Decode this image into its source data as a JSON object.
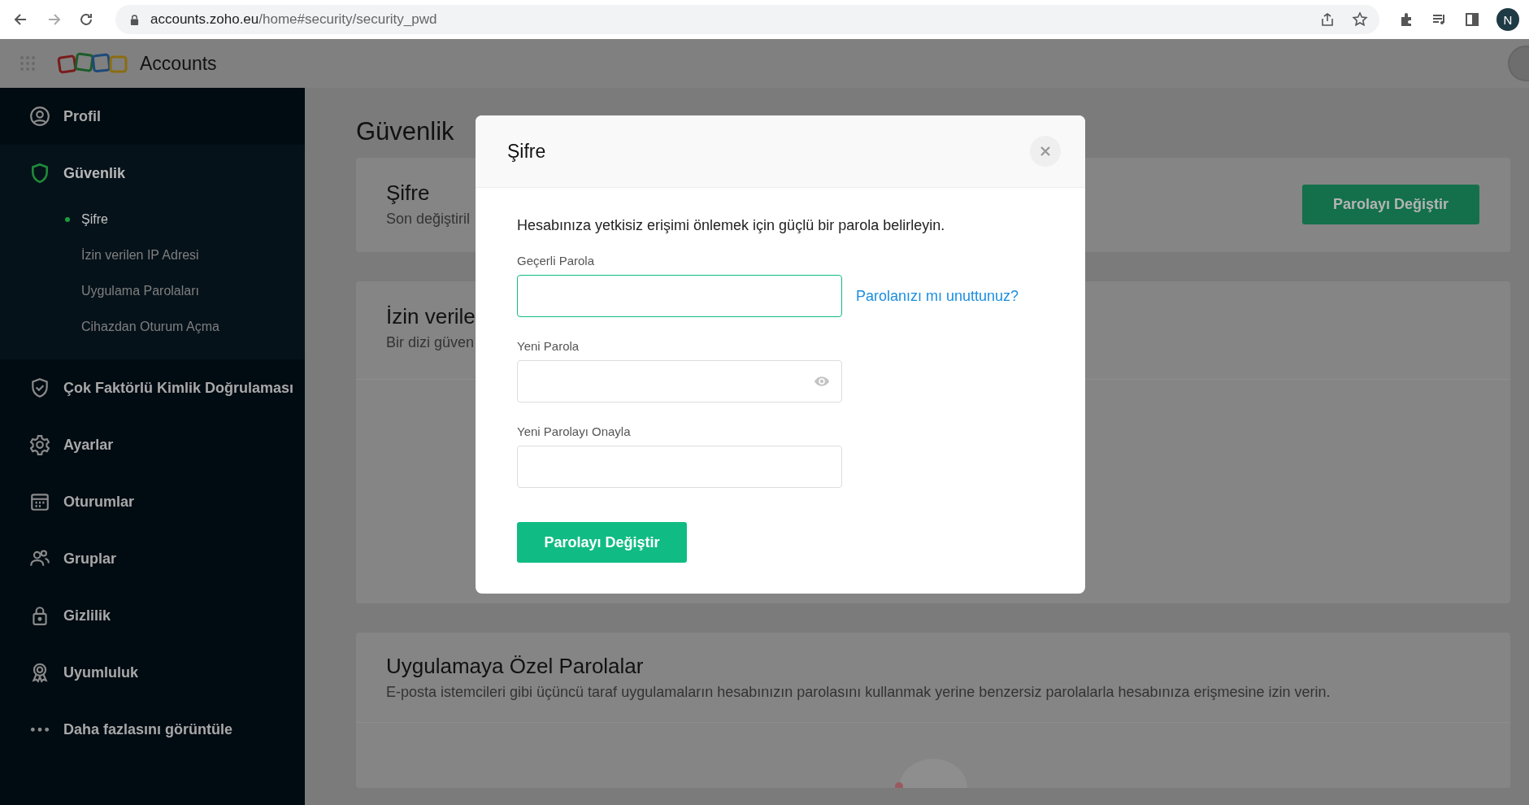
{
  "browser": {
    "url_host": "accounts.zoho.eu",
    "url_path": "/home#security/security_pwd",
    "profile_initial": "N"
  },
  "header": {
    "title": "Accounts"
  },
  "sidebar": {
    "items": [
      {
        "label": "Profil",
        "selected": false
      },
      {
        "label": "Güvenlik",
        "selected": true,
        "expanded": true,
        "children": [
          {
            "label": "Şifre",
            "selected": true
          },
          {
            "label": "İzin verilen IP Adresi",
            "selected": false
          },
          {
            "label": "Uygulama Parolaları",
            "selected": false
          },
          {
            "label": "Cihazdan Oturum Açma",
            "selected": false
          }
        ]
      },
      {
        "label": "Çok Faktörlü Kimlik Doğrulaması",
        "selected": false
      },
      {
        "label": "Ayarlar",
        "selected": false
      },
      {
        "label": "Oturumlar",
        "selected": false
      },
      {
        "label": "Gruplar",
        "selected": false
      },
      {
        "label": "Gizlilik",
        "selected": false
      },
      {
        "label": "Uyumluluk",
        "selected": false
      },
      {
        "label": "Daha fazlasını görüntüle",
        "selected": false
      }
    ]
  },
  "page": {
    "title": "Güvenlik",
    "cards": [
      {
        "title": "Şifre",
        "subtitle": "Son değiştiril",
        "button": "Parolayı Değiştir"
      },
      {
        "title": "İzin verile",
        "subtitle": "Bir dizi güven"
      },
      {
        "title": "Uygulamaya Özel Parolalar",
        "subtitle": "E-posta istemcileri gibi üçüncü taraf uygulamaların hesabınızın parolasını kullanmak yerine benzersiz parolalarla hesabınıza erişmesine izin verin."
      }
    ]
  },
  "modal": {
    "title": "Şifre",
    "description": "Hesabınıza yetkisiz erişimi önlemek için güçlü bir parola belirleyin.",
    "fields": [
      {
        "label": "Geçerli Parola",
        "focused": true,
        "link": "Parolanızı mı unuttunuz?"
      },
      {
        "label": "Yeni Parola",
        "focused": false,
        "reveal": true
      },
      {
        "label": "Yeni Parolayı Onayla",
        "focused": false
      }
    ],
    "submit": "Parolayı Değiştir"
  }
}
